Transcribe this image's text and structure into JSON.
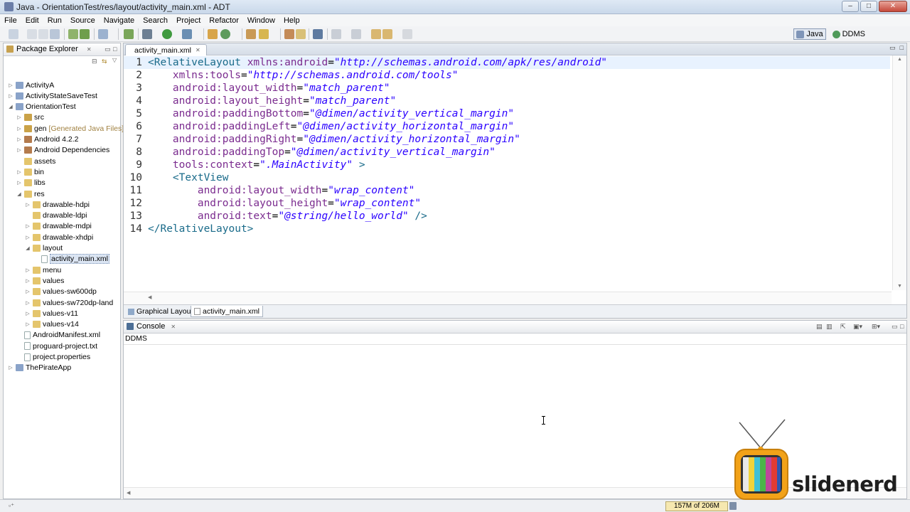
{
  "window": {
    "title": "Java - OrientationTest/res/layout/activity_main.xml - ADT",
    "controls": {
      "minimize": "–",
      "maximize": "□",
      "close": "✕"
    }
  },
  "menu": [
    "File",
    "Edit",
    "Run",
    "Source",
    "Navigate",
    "Search",
    "Project",
    "Refactor",
    "Window",
    "Help"
  ],
  "perspectives": [
    {
      "label": "Java",
      "active": true
    },
    {
      "label": "DDMS",
      "active": false
    }
  ],
  "package_explorer": {
    "title": "Package Explorer",
    "items": [
      {
        "label": "ActivityA",
        "depth": 0,
        "twisty": "▷",
        "icon": "project-icon"
      },
      {
        "label": "ActivityStateSaveTest",
        "depth": 0,
        "twisty": "▷",
        "icon": "project-icon"
      },
      {
        "label": "OrientationTest",
        "depth": 0,
        "twisty": "◢",
        "icon": "project-icon"
      },
      {
        "label": "src",
        "depth": 1,
        "twisty": "▷",
        "icon": "source-folder-icon"
      },
      {
        "label": "gen",
        "suffix": "[Generated Java Files]",
        "depth": 1,
        "twisty": "▷",
        "icon": "source-folder-icon"
      },
      {
        "label": "Android 4.2.2",
        "depth": 1,
        "twisty": "▷",
        "icon": "library-icon"
      },
      {
        "label": "Android Dependencies",
        "depth": 1,
        "twisty": "▷",
        "icon": "library-icon"
      },
      {
        "label": "assets",
        "depth": 1,
        "twisty": "",
        "icon": "folder-icon"
      },
      {
        "label": "bin",
        "depth": 1,
        "twisty": "▷",
        "icon": "folder-icon"
      },
      {
        "label": "libs",
        "depth": 1,
        "twisty": "▷",
        "icon": "folder-icon"
      },
      {
        "label": "res",
        "depth": 1,
        "twisty": "◢",
        "icon": "folder-icon"
      },
      {
        "label": "drawable-hdpi",
        "depth": 2,
        "twisty": "▷",
        "icon": "folder-icon"
      },
      {
        "label": "drawable-ldpi",
        "depth": 2,
        "twisty": "",
        "icon": "folder-icon"
      },
      {
        "label": "drawable-mdpi",
        "depth": 2,
        "twisty": "▷",
        "icon": "folder-icon"
      },
      {
        "label": "drawable-xhdpi",
        "depth": 2,
        "twisty": "▷",
        "icon": "folder-icon"
      },
      {
        "label": "layout",
        "depth": 2,
        "twisty": "◢",
        "icon": "folder-icon"
      },
      {
        "label": "activity_main.xml",
        "depth": 3,
        "twisty": "",
        "icon": "xml-file-icon",
        "selected": true
      },
      {
        "label": "menu",
        "depth": 2,
        "twisty": "▷",
        "icon": "folder-icon"
      },
      {
        "label": "values",
        "depth": 2,
        "twisty": "▷",
        "icon": "folder-icon"
      },
      {
        "label": "values-sw600dp",
        "depth": 2,
        "twisty": "▷",
        "icon": "folder-icon"
      },
      {
        "label": "values-sw720dp-land",
        "depth": 2,
        "twisty": "▷",
        "icon": "folder-icon"
      },
      {
        "label": "values-v11",
        "depth": 2,
        "twisty": "▷",
        "icon": "folder-icon"
      },
      {
        "label": "values-v14",
        "depth": 2,
        "twisty": "▷",
        "icon": "folder-icon"
      },
      {
        "label": "AndroidManifest.xml",
        "depth": 1,
        "twisty": "",
        "icon": "xml-file-icon"
      },
      {
        "label": "proguard-project.txt",
        "depth": 1,
        "twisty": "",
        "icon": "text-file-icon"
      },
      {
        "label": "project.properties",
        "depth": 1,
        "twisty": "",
        "icon": "text-file-icon"
      },
      {
        "label": "ThePirateApp",
        "depth": 0,
        "twisty": "▷",
        "icon": "project-icon"
      }
    ]
  },
  "editor": {
    "tab": "activity_main.xml",
    "lines": [
      [
        [
          "tag",
          "<RelativeLayout "
        ],
        [
          "attr",
          "xmlns:android"
        ],
        [
          "plain",
          "="
        ],
        [
          "val",
          "\"http://schemas.android.com/apk/res/android\""
        ]
      ],
      [
        [
          "plain",
          "    "
        ],
        [
          "attr",
          "xmlns:tools"
        ],
        [
          "plain",
          "="
        ],
        [
          "val",
          "\"http://schemas.android.com/tools\""
        ]
      ],
      [
        [
          "plain",
          "    "
        ],
        [
          "attr",
          "android:layout_width"
        ],
        [
          "plain",
          "="
        ],
        [
          "val",
          "\"match_parent\""
        ]
      ],
      [
        [
          "plain",
          "    "
        ],
        [
          "attr",
          "android:layout_height"
        ],
        [
          "plain",
          "="
        ],
        [
          "val",
          "\"match_parent\""
        ]
      ],
      [
        [
          "plain",
          "    "
        ],
        [
          "attr",
          "android:paddingBottom"
        ],
        [
          "plain",
          "="
        ],
        [
          "val",
          "\"@dimen/activity_vertical_margin\""
        ]
      ],
      [
        [
          "plain",
          "    "
        ],
        [
          "attr",
          "android:paddingLeft"
        ],
        [
          "plain",
          "="
        ],
        [
          "val",
          "\"@dimen/activity_horizontal_margin\""
        ]
      ],
      [
        [
          "plain",
          "    "
        ],
        [
          "attr",
          "android:paddingRight"
        ],
        [
          "plain",
          "="
        ],
        [
          "val",
          "\"@dimen/activity_horizontal_margin\""
        ]
      ],
      [
        [
          "plain",
          "    "
        ],
        [
          "attr",
          "android:paddingTop"
        ],
        [
          "plain",
          "="
        ],
        [
          "val",
          "\"@dimen/activity_vertical_margin\""
        ]
      ],
      [
        [
          "plain",
          "    "
        ],
        [
          "attr",
          "tools:context"
        ],
        [
          "plain",
          "="
        ],
        [
          "val",
          "\".MainActivity\""
        ],
        [
          "tag",
          " >"
        ]
      ],
      [
        [
          "plain",
          "    "
        ],
        [
          "tag",
          "<TextView"
        ]
      ],
      [
        [
          "plain",
          "        "
        ],
        [
          "attr",
          "android:layout_width"
        ],
        [
          "plain",
          "="
        ],
        [
          "val",
          "\"wrap_content\""
        ]
      ],
      [
        [
          "plain",
          "        "
        ],
        [
          "attr",
          "android:layout_height"
        ],
        [
          "plain",
          "="
        ],
        [
          "val",
          "\"wrap_content\""
        ]
      ],
      [
        [
          "plain",
          "        "
        ],
        [
          "attr",
          "android:text"
        ],
        [
          "plain",
          "="
        ],
        [
          "val",
          "\"@string/hello_world\""
        ],
        [
          "tag",
          " />"
        ]
      ],
      [
        [
          "tag",
          "</RelativeLayout>"
        ]
      ]
    ],
    "bottom_tabs": [
      {
        "label": "Graphical Layout",
        "active": false
      },
      {
        "label": "activity_main.xml",
        "active": true
      }
    ]
  },
  "console": {
    "title": "Console",
    "subtitle": "DDMS"
  },
  "status": {
    "memory": "157M of 206M"
  },
  "watermark": {
    "brand": "slidenerd"
  },
  "colors": {
    "xml_tag": "#1a6b8a",
    "xml_attr": "#7b2c8f",
    "xml_value": "#2a00ff",
    "current_line": "#e8f2fe",
    "selection": "#dbe5f3"
  }
}
